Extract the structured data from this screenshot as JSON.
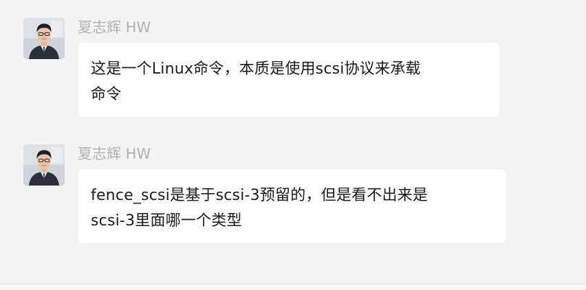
{
  "messages": [
    {
      "sender": "夏志辉 HW",
      "text": "这是一个Linux命令，本质是使用scsi协议来承载\n命令"
    },
    {
      "sender": "夏志辉 HW",
      "text": "fence_scsi是基于scsi-3预留的，但是看不出来是\nscsi-3里面哪一个类型"
    }
  ],
  "colors": {
    "background": "#f3f3f3",
    "bubble": "#ffffff",
    "sender_name": "#b3b3b3",
    "message_text": "#1a1a1a"
  },
  "icons": {
    "avatar": "user-photo-avatar"
  }
}
